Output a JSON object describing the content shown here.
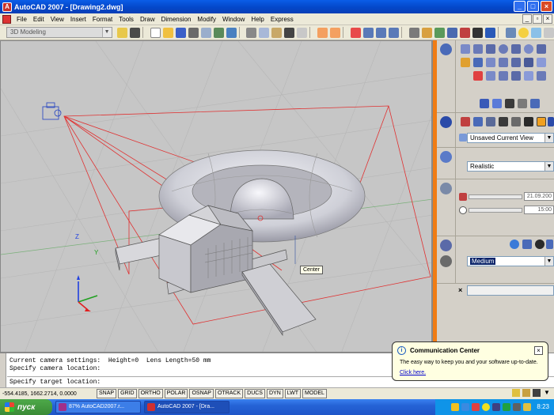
{
  "window": {
    "title": "AutoCAD 2007 - [Drawing2.dwg]",
    "btn_min": "_",
    "btn_max": "□",
    "btn_close": "×"
  },
  "menu": [
    "File",
    "Edit",
    "View",
    "Insert",
    "Format",
    "Tools",
    "Draw",
    "Dimension",
    "Modify",
    "Window",
    "Help",
    "Express"
  ],
  "toolbar": {
    "workspace": "3D Modeling"
  },
  "viewport": {
    "tooltip": "Center",
    "axis_z": "Z",
    "axis_y": "Y"
  },
  "dashboard": {
    "view_select": "Unsaved Current View",
    "visual_style": "Realistic",
    "date_field": "21.09.200",
    "time_field": "15:00",
    "render_preset": "Medium",
    "mat_x": "×"
  },
  "command": {
    "line1": "Current camera settings:  Height=0  Lens Length=50 mm",
    "line2": "Specify camera location:",
    "line3": "Specify target location:"
  },
  "balloon": {
    "title": "Communication Center",
    "text": "The easy way to keep you and your software up-to-date.",
    "link": "Click here.",
    "close": "×"
  },
  "statusbar": {
    "coords": "-554.4185, 1662.2714, 0.0000",
    "buttons": [
      "SNAP",
      "GRID",
      "ORTHO",
      "POLAR",
      "OSNAP",
      "OTRACK",
      "DUCS",
      "DYN",
      "LWT",
      "MODEL"
    ]
  },
  "taskbar": {
    "start": "пуск",
    "task1": "87% AutoCAD2007.r...",
    "task2": "AutoCAD 2007 - [Dra...",
    "clock": "8:23"
  },
  "colors": {
    "viewport_bg": "#c6c6c6",
    "camera_lines": "#e03030",
    "palette_handle": "#f07c14",
    "title_bar": "#0447c9"
  }
}
